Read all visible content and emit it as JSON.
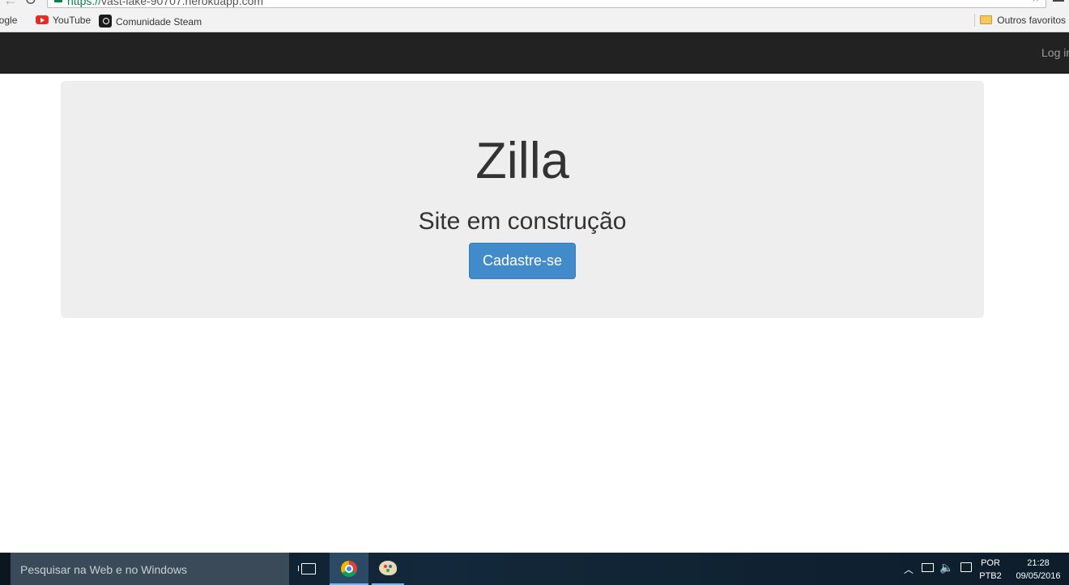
{
  "browser": {
    "url_scheme": "https://",
    "url_host": "vast-lake-90707.herokuapp.com",
    "bookmarks": {
      "google": "oogle",
      "youtube": "YouTube",
      "steam": "Comunidade Steam",
      "others": "Outros favoritos"
    }
  },
  "navbar": {
    "login": "Log in"
  },
  "jumbotron": {
    "title": "Zilla",
    "subtitle": "Site em construção",
    "button_label": "Cadastre-se",
    "button_color": "#428bca"
  },
  "taskbar": {
    "search_placeholder": "Pesquisar na Web e no Windows",
    "lang_line1": "POR",
    "lang_line2": "PTB2",
    "time": "21:28",
    "date": "09/05/2016"
  }
}
